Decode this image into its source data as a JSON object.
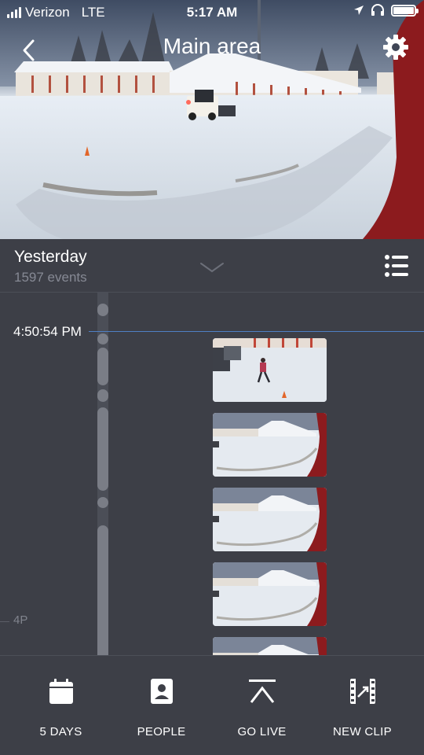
{
  "status_bar": {
    "carrier": "Verizon",
    "network": "LTE",
    "time": "5:17 AM",
    "icons": [
      "signal-icon",
      "location-arrow-icon",
      "headphones-icon",
      "battery-icon"
    ]
  },
  "nav": {
    "title": "Main area",
    "back_icon": "chevron-left-icon",
    "settings_icon": "gear-icon"
  },
  "day": {
    "label": "Yesterday",
    "event_count": "1597 events"
  },
  "timeline": {
    "current_time": "4:50:54 PM",
    "hour_marker": "4P",
    "clips": [
      {
        "name": "event-clip-1",
        "scene": "person-in-snow"
      },
      {
        "name": "event-clip-2",
        "scene": "parking-lot"
      },
      {
        "name": "event-clip-3",
        "scene": "parking-lot"
      },
      {
        "name": "event-clip-4",
        "scene": "parking-lot"
      },
      {
        "name": "event-clip-5",
        "scene": "parking-lot"
      }
    ]
  },
  "toolbar": {
    "days_label": "5 DAYS",
    "people_label": "PEOPLE",
    "live_label": "GO LIVE",
    "clip_label": "NEW CLIP"
  },
  "colors": {
    "background": "#3d3f47",
    "accent_line": "#4f7fc4",
    "track": "#4b4e57",
    "event_marker": "#7a7d86",
    "muted_text": "#868994"
  }
}
